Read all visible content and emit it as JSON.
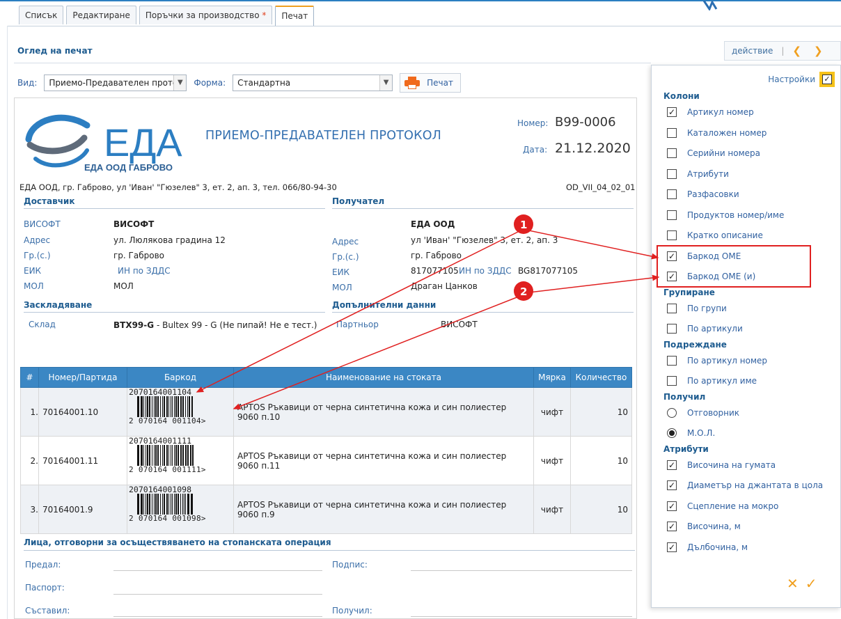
{
  "tabs": [
    {
      "label": "Списък"
    },
    {
      "label": "Редактиране"
    },
    {
      "label": "Поръчки за производство",
      "star": "*"
    },
    {
      "label": "Печат",
      "active": true
    }
  ],
  "preview_title": "Оглед на печат",
  "actions": {
    "label": "действие",
    "separator": "|",
    "prev": "‹",
    "next": "›"
  },
  "view": {
    "view_label": "Вид:",
    "view_value": "Приемо-Предавателен протс",
    "form_label": "Форма:",
    "form_value": "Стандартна",
    "print_label": "Печат"
  },
  "document": {
    "logo_text": "ЕДА",
    "logo_sub": "ЕДА ООД ГАБРОВО",
    "title": "ПРИЕМО-ПРЕДАВАТЕЛЕН ПРОТОКОЛ",
    "number_label": "Номер:",
    "number": "B99-0006",
    "date_label": "Дата:",
    "date": "21.12.2020",
    "company_line": "ЕДА ООД, гр. Габрово, ул 'Иван' \"Гюзелев\" 3, ет. 2, ап. 3, тел. 066/80-94-30",
    "form_code": "OD_VII_04_02_01",
    "supplier": {
      "heading": "Доставчик",
      "name_k": "ВИСОФТ",
      "name_v": "ВИСОФТ",
      "addr_k": "Адрес",
      "addr_v": "ул. Люлякова градина 12",
      "city_k": "Гр.(с.)",
      "city_v": "гр. Габрово",
      "eik_k": "ЕИК",
      "eik_v": "",
      "vat_k": "ИН по ЗДДС",
      "vat_v": "",
      "mol_k": "МОЛ",
      "mol_v": "МОЛ"
    },
    "receiver": {
      "heading": "Получател",
      "name_v": "ЕДА ООД",
      "addr_k": "Адрес",
      "addr_v": "ул 'Иван' \"Гюзелев\" 3, ет. 2, ап. 3",
      "city_k": "Гр.(с.)",
      "city_v": "гр. Габрово",
      "eik_k": "ЕИК",
      "eik_v": "817077105",
      "vat_k": "ИН по ЗДДС",
      "vat_v": "BG817077105",
      "mol_k": "МОЛ",
      "mol_v": "Драган Цанков"
    },
    "storage": {
      "heading": "Заскладяване",
      "key": "Склад",
      "value_bold": "BTX99-G",
      "value_rest": " - Bultex 99 - G (Не пипай! Не е тест.)"
    },
    "extra": {
      "heading": "Допълнителни данни",
      "key": "Партньор",
      "value": "ВИСОФТ"
    },
    "table": {
      "headers": [
        "#",
        "Номер/Партида",
        "Баркод",
        "Наименование на стоката",
        "Мярка",
        "Количество"
      ],
      "rows": [
        {
          "idx": "1.",
          "batch": "70164001.10",
          "barcode": "2070164001104",
          "bc_a": "2",
          "bc_b": "070164",
          "bc_c": "001104",
          "name": "APTOS Ръкавици от черна синтетична кожа и син полиестер 9060 п.10",
          "unit": "чифт",
          "qty": "10"
        },
        {
          "idx": "2.",
          "batch": "70164001.11",
          "barcode": "2070164001111",
          "bc_a": "2",
          "bc_b": "070164",
          "bc_c": "001111",
          "name": "APTOS Ръкавици от черна синтетична кожа и син полиестер 9060 п.11",
          "unit": "чифт",
          "qty": "10"
        },
        {
          "idx": "3.",
          "batch": "70164001.9",
          "barcode": "2070164001098",
          "bc_a": "2",
          "bc_b": "070164",
          "bc_c": "001098",
          "name": "APTOS Ръкавици от черна синтетична кожа и син полиестер 9060 п.9",
          "unit": "чифт",
          "qty": "10"
        }
      ]
    },
    "responsible": {
      "heading": "Лица, отговорни за осъществяването на стопанската операция",
      "handed": "Предал:",
      "sign": "Подпис:",
      "passport": "Паспорт:",
      "composed": "Съставил:",
      "received": "Получил:"
    }
  },
  "settings": {
    "title": "Настройки",
    "columns_h": "Колони",
    "columns": [
      {
        "label": "Артикул номер",
        "checked": true
      },
      {
        "label": "Каталожен номер",
        "checked": false
      },
      {
        "label": "Серийни номера",
        "checked": false
      },
      {
        "label": "Атрибути",
        "checked": false
      },
      {
        "label": "Разфасовки",
        "checked": false
      },
      {
        "label": "Продуктов номер/име",
        "checked": false
      },
      {
        "label": "Кратко описание",
        "checked": false
      },
      {
        "label": "Баркод ОМЕ",
        "checked": true
      },
      {
        "label": "Баркод ОМЕ (и)",
        "checked": true
      }
    ],
    "group_h": "Групиране",
    "group": [
      {
        "label": "По групи",
        "checked": false
      },
      {
        "label": "По артикули",
        "checked": false
      }
    ],
    "sort_h": "Подреждане",
    "sort": [
      {
        "label": "По артикул номер",
        "checked": false
      },
      {
        "label": "По артикул име",
        "checked": false
      }
    ],
    "recv_h": "Получил",
    "recv": [
      {
        "label": "Отговорник",
        "selected": false
      },
      {
        "label": "М.О.Л.",
        "selected": true
      }
    ],
    "attr_h": "Атрибути",
    "attrs": [
      {
        "label": "Височина на гумата",
        "checked": true
      },
      {
        "label": "Диаметър на джантата в цола",
        "checked": true
      },
      {
        "label": "Сцепление на мокро",
        "checked": true
      },
      {
        "label": "Височина, м",
        "checked": true
      },
      {
        "label": "Дълбочина, м",
        "checked": true
      }
    ],
    "cancel": "✕",
    "ok": "✓"
  },
  "annotations": {
    "marker1": "1",
    "marker2": "2"
  },
  "colors": {
    "accent": "#f0a020",
    "link": "#3a6ea8",
    "header_blue": "#3b87c4",
    "annot_red": "#e02020"
  }
}
